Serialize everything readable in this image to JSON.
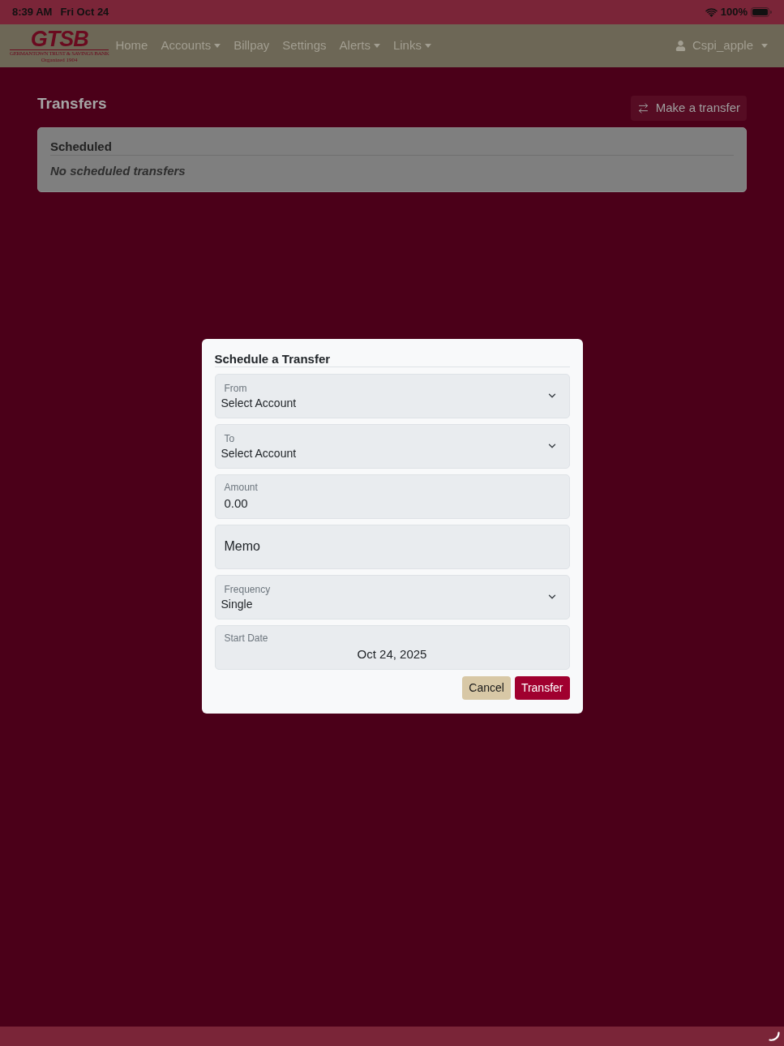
{
  "status_bar": {
    "time": "8:39 AM",
    "date": "Fri Oct 24",
    "battery": "100%"
  },
  "navbar": {
    "logo": {
      "mark": "GTSB",
      "name": "GERMANTOWN TRUST & SAVINGS BANK",
      "tagline": "Organized 1904"
    },
    "items": [
      {
        "label": "Home",
        "dropdown": false
      },
      {
        "label": "Accounts",
        "dropdown": true
      },
      {
        "label": "Billpay",
        "dropdown": false
      },
      {
        "label": "Settings",
        "dropdown": false
      },
      {
        "label": "Alerts",
        "dropdown": true
      },
      {
        "label": "Links",
        "dropdown": true
      }
    ],
    "user": {
      "label": "Cspi_apple",
      "dropdown": true
    }
  },
  "page": {
    "title": "Transfers",
    "action": "Make a transfer"
  },
  "scheduled": {
    "title": "Scheduled",
    "empty_message": "No scheduled transfers"
  },
  "modal": {
    "title": "Schedule a Transfer",
    "fields": [
      {
        "kind": "select",
        "label": "From",
        "value": "Select Account"
      },
      {
        "kind": "select",
        "label": "To",
        "value": "Select Account"
      },
      {
        "kind": "input",
        "label": "Amount",
        "value": "0.00"
      },
      {
        "kind": "text",
        "placeholder": "Memo"
      },
      {
        "kind": "select",
        "label": "Frequency",
        "value": "Single"
      },
      {
        "kind": "date",
        "label": "Start Date",
        "value": "Oct 24, 2025"
      }
    ],
    "buttons": [
      {
        "kind": "secondary",
        "label": "Cancel"
      },
      {
        "kind": "primary",
        "label": "Transfer"
      }
    ]
  }
}
